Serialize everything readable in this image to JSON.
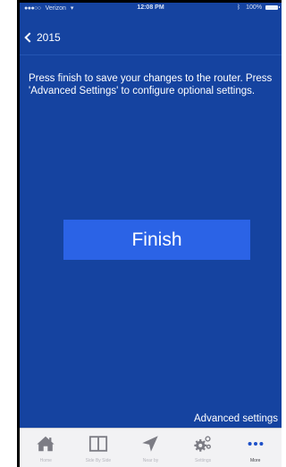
{
  "status_bar": {
    "carrier": "Verizon",
    "time": "12:08 PM",
    "battery": "100%"
  },
  "nav": {
    "back_label": "2015"
  },
  "main": {
    "instructions": "Press finish to save your changes to the router. Press 'Advanced Settings' to configure optional settings.",
    "finish_label": "Finish",
    "advanced_label": "Advanced settings"
  },
  "tab_bar": {
    "items": [
      {
        "label": "Home",
        "icon": "home-icon"
      },
      {
        "label": "Side By Side",
        "icon": "side-by-side-icon"
      },
      {
        "label": "Near by",
        "icon": "location-arrow-icon"
      },
      {
        "label": "Settings",
        "icon": "gears-icon"
      },
      {
        "label": "More",
        "icon": "more-icon"
      }
    ],
    "active": "More"
  },
  "colors": {
    "background": "#1543a0",
    "button": "#2b63e6",
    "tab_bar": "#f2f2f4",
    "tab_icon": "#7c7c84"
  }
}
